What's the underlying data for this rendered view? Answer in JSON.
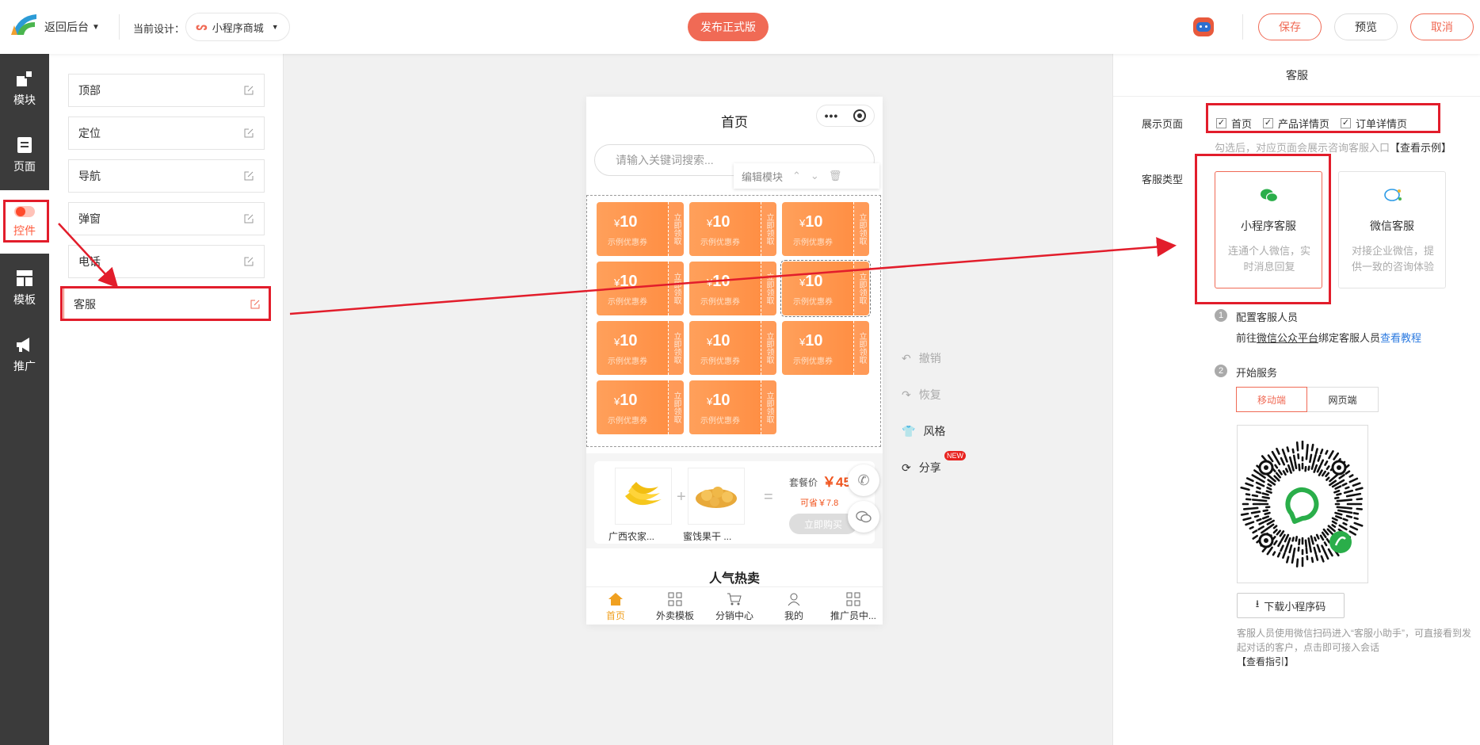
{
  "header": {
    "back_label": "返回后台",
    "current_design_label": "当前设计：",
    "design_name": "小程序商城",
    "publish_label": "发布正式版",
    "save_label": "保存",
    "preview_label": "预览",
    "cancel_label": "取消"
  },
  "rail": [
    {
      "label": "模块",
      "icon": "blocks-icon"
    },
    {
      "label": "页面",
      "icon": "page-icon"
    },
    {
      "label": "控件",
      "icon": "toggle-icon",
      "active": true
    },
    {
      "label": "模板",
      "icon": "template-icon"
    },
    {
      "label": "推广",
      "icon": "megaphone-icon"
    }
  ],
  "widgets": [
    "顶部",
    "定位",
    "导航",
    "弹窗",
    "电话",
    "客服"
  ],
  "phone": {
    "title": "首页",
    "search_placeholder": "请输入关键词搜索...",
    "edit_module_label": "编辑模块",
    "coupon_amount": "10",
    "coupon_currency": "¥",
    "coupon_sub": "示例优惠券",
    "coupon_stub": "立即领取",
    "combo": {
      "item1": "广西农家...",
      "item2": "蜜饯果干 ...",
      "price_label": "套餐价",
      "price": "￥45",
      "save": "可省￥7.8",
      "buy": "立即购买",
      "plus": "+",
      "equals": "="
    },
    "next_section": "人气热卖",
    "tabs": [
      "首页",
      "外卖模板",
      "分销中心",
      "我的",
      "推广员中..."
    ]
  },
  "tools": {
    "undo": "撤销",
    "redo": "恢复",
    "style": "风格",
    "share": "分享",
    "new_badge": "NEW"
  },
  "panel": {
    "title": "客服",
    "show_page_label": "展示页面",
    "pages": [
      "首页",
      "产品详情页",
      "订单详情页"
    ],
    "hint": "勾选后，对应页面会展示咨询客服入口",
    "hint_link": "【查看示例】",
    "type_label": "客服类型",
    "types": [
      {
        "title": "小程序客服",
        "desc": "连通个人微信，实时消息回复",
        "selected": true
      },
      {
        "title": "微信客服",
        "desc": "对接企业微信，提供一致的咨询体验",
        "selected": false
      }
    ],
    "step1_num": "1",
    "step1_title": "配置客服人员",
    "step1_text_a": "前往",
    "step1_link": "微信公众平台",
    "step1_text_b": "绑定客服人员",
    "step1_tutorial": "查看教程",
    "step2_num": "2",
    "step2_title": "开始服务",
    "service_tabs": [
      "移动端",
      "网页端"
    ],
    "download_label": "下载小程序码",
    "note": "客服人员使用微信扫码进入“客服小助手”，可直接看到发起对话的客户，点击即可接入会话",
    "guide_link": "【查看指引】"
  },
  "colors": {
    "accent": "#f06a55",
    "rail": "#3b3b3b",
    "coupon": "#ff9a50",
    "annotation": "#e21d2b",
    "wechat": "#2aae4a"
  }
}
